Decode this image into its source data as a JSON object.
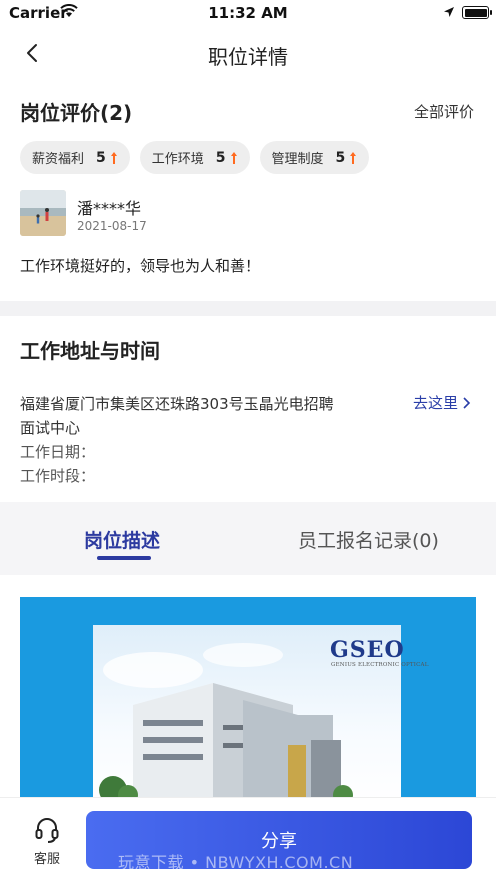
{
  "status_bar": {
    "carrier": "Carrier",
    "time": "11:32 AM",
    "battery_level": 1.0
  },
  "nav": {
    "title": "职位详情"
  },
  "reviews_section": {
    "title": "岗位评价(2)",
    "all_reviews_link": "全部评价",
    "tags": [
      {
        "label": "薪资福利",
        "score": "5"
      },
      {
        "label": "工作环境",
        "score": "5"
      },
      {
        "label": "管理制度",
        "score": "5"
      }
    ],
    "review": {
      "name": "潘****华",
      "date": "2021-08-17",
      "text": "工作环境挺好的，领导也为人和善！"
    }
  },
  "location_section": {
    "title": "工作地址与时间",
    "address_line1": "福建省厦门市集美区还珠路303号玉晶光电招聘",
    "address_line2": "面试中心",
    "go_there": "去这里",
    "work_date_label": "工作日期：",
    "work_time_label": "工作时段："
  },
  "tabs": {
    "active": "岗位描述",
    "inactive": "员工报名记录(0)"
  },
  "banner": {
    "brand": "GSEO",
    "brand_sub": "GENIUS ELECTRONIC OPTICAL"
  },
  "bottom": {
    "service_label": "客服",
    "share_label": "分享",
    "watermark": "玩意下载 • NBWYXH.COM.CN"
  },
  "colors": {
    "accent": "#2c3aa0",
    "arrow": "#ff6a1f",
    "banner_blue": "#1a9ae0",
    "button": "#3a55e0"
  }
}
